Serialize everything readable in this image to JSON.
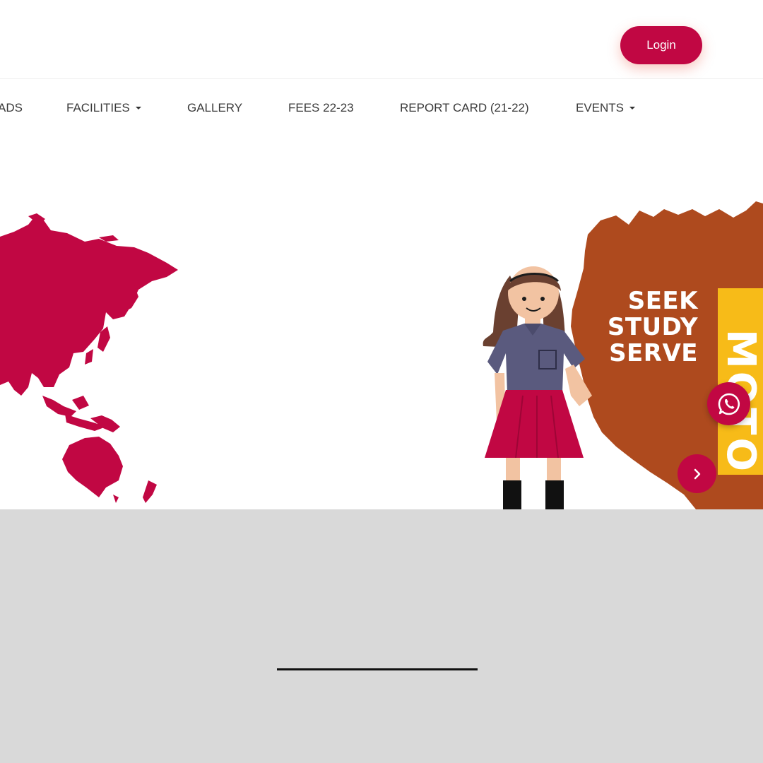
{
  "header": {
    "login_label": "Login"
  },
  "nav": {
    "items": [
      {
        "label": "ADS",
        "has_dropdown": false
      },
      {
        "label": "FACILITIES",
        "has_dropdown": true
      },
      {
        "label": "GALLERY",
        "has_dropdown": false
      },
      {
        "label": "FEES 22-23",
        "has_dropdown": false
      },
      {
        "label": "REPORT CARD (21-22)",
        "has_dropdown": false
      },
      {
        "label": "EVENTS",
        "has_dropdown": true
      }
    ]
  },
  "hero": {
    "motto_lines": [
      "SEEK",
      "STUDY",
      "SERVE"
    ],
    "motto_side_word": "MOTO",
    "colors": {
      "map": "#c10743",
      "splash": "#ae4a1e",
      "motto_bar": "#f7bb18",
      "accent": "#c10743"
    }
  },
  "floating": {
    "whatsapp_icon": "whatsapp-icon",
    "next_icon": "chevron-right-icon"
  }
}
